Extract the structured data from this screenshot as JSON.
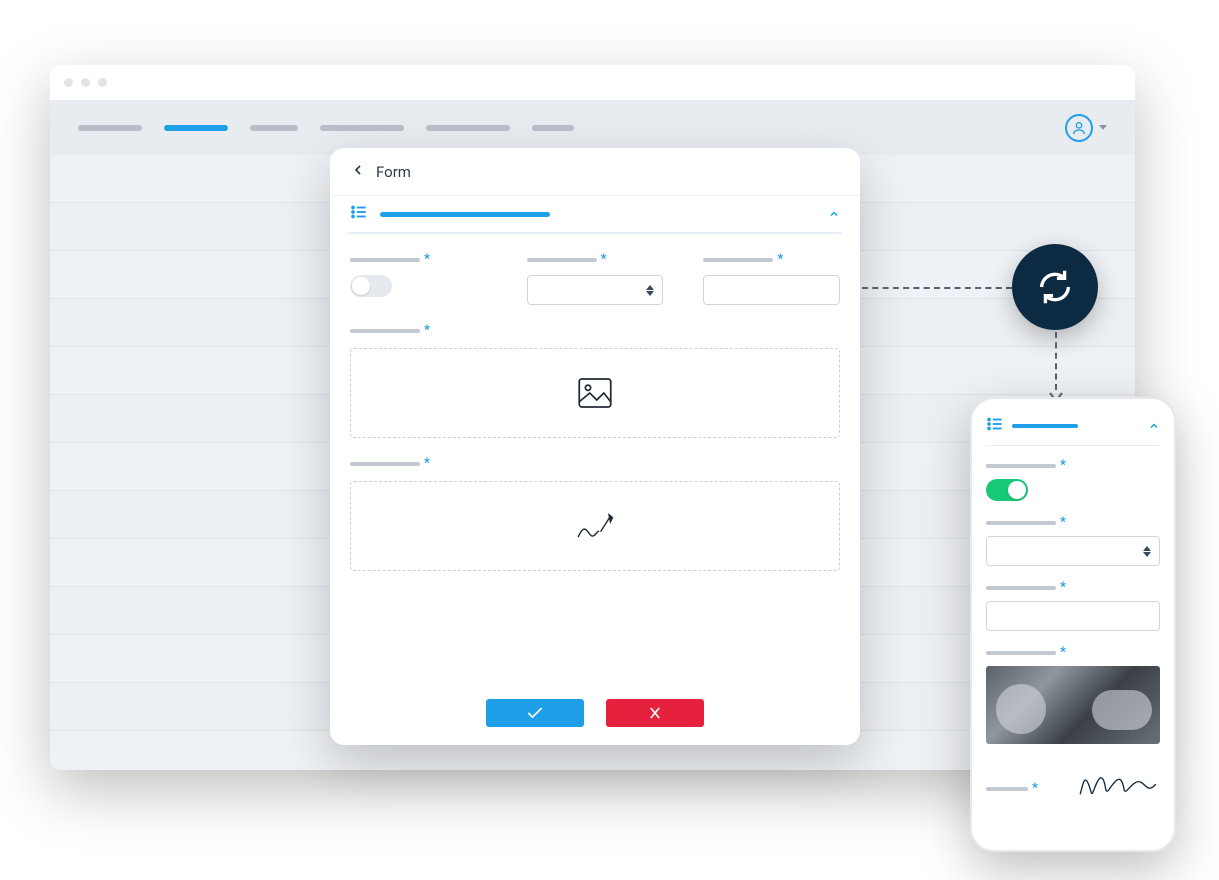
{
  "dialog": {
    "title": "Form",
    "required_marker": "*",
    "confirm_action": "confirm",
    "cancel_action": "cancel"
  },
  "form": {
    "section": {
      "expanded": true
    },
    "fields": {
      "toggle": {
        "required": true,
        "value": false
      },
      "select": {
        "required": true,
        "value": ""
      },
      "text": {
        "required": true,
        "value": ""
      },
      "image": {
        "required": true
      },
      "signature": {
        "required": true
      }
    }
  },
  "mobile": {
    "section": {
      "expanded": true
    },
    "fields": {
      "toggle": {
        "required": true,
        "value": true
      },
      "select": {
        "required": true,
        "value": ""
      },
      "text": {
        "required": true,
        "value": ""
      },
      "image": {
        "required": true,
        "has_photo": true
      },
      "signature": {
        "required": true,
        "signed": true
      }
    }
  },
  "colors": {
    "accent": "#1f9fe8",
    "success": "#17c977",
    "danger": "#e5213d",
    "sync": "#0d2a43"
  }
}
